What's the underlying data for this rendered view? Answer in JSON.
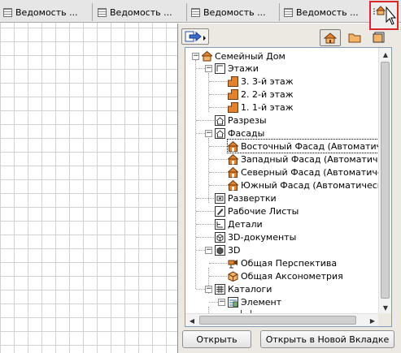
{
  "tabs": [
    {
      "label": "Ведомость ..."
    },
    {
      "label": "Ведомость ..."
    },
    {
      "label": "Ведомость ..."
    },
    {
      "label": "Ведомость ..."
    }
  ],
  "tree": {
    "root": "Семейный Дом",
    "floors_group": "Этажи",
    "floors": [
      "3. 3-й этаж",
      "2. 2-й этаж",
      "1. 1-й этаж"
    ],
    "sections": "Разрезы",
    "facades_group": "Фасады",
    "facades": [
      "Восточный Фасад (Автоматиче",
      "Западный Фасад (Автоматичес",
      "Северный Фасад (Автоматичес",
      "Южный Фасад (Автоматически"
    ],
    "interior": "Развертки",
    "worksheets": "Рабочие Листы",
    "details": "Детали",
    "docs3d": "3D-документы",
    "group3d": "3D",
    "perspective": "Общая Перспектива",
    "axonometry": "Общая Аксонометрия",
    "catalogs": "Каталоги",
    "element": "Элемент"
  },
  "buttons": {
    "open": "Открыть",
    "open_new_tab": "Открыть в Новой Вкладке"
  },
  "colors": {
    "highlight_border": "#d8272d",
    "house_orange": "#e0822f",
    "selection_outline": "#000000"
  }
}
